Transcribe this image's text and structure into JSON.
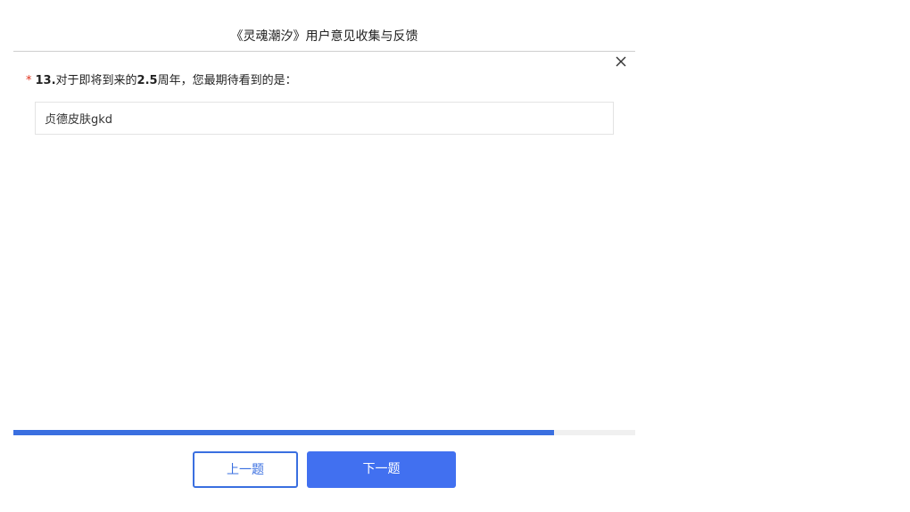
{
  "survey": {
    "title": "《灵魂潮汐》用户意见收集与反馈"
  },
  "question": {
    "required_mark": "*",
    "number": "13.",
    "text_before": "对于即将到来的",
    "text_emph": "2.5",
    "text_after": "周年，您最期待看到的是："
  },
  "answer": {
    "value": "贞德皮肤gkd"
  },
  "progress": {
    "fraction": 0.869,
    "color": "#3a6fe0"
  },
  "buttons": {
    "prev_label": "上一题",
    "next_label": "下一题"
  },
  "icons": {
    "close": "close-icon"
  },
  "colors": {
    "accent": "#4170f0",
    "required": "#e0321e"
  }
}
